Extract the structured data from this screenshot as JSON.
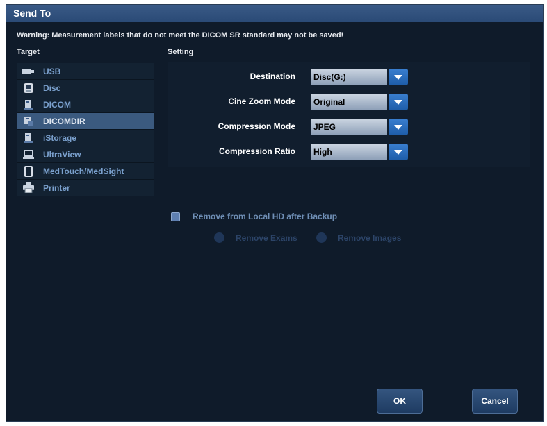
{
  "dialog": {
    "title": "Send To",
    "warning": "Warning: Measurement labels that do not meet the DICOM SR standard may not be saved!"
  },
  "target": {
    "label": "Target",
    "items": [
      {
        "label": "USB",
        "icon": "usb-icon"
      },
      {
        "label": "Disc",
        "icon": "disc-icon"
      },
      {
        "label": "DICOM",
        "icon": "dicom-icon"
      },
      {
        "label": "DICOMDIR",
        "icon": "dicomdir-icon",
        "selected": true
      },
      {
        "label": "iStorage",
        "icon": "istorage-icon"
      },
      {
        "label": "UltraView",
        "icon": "laptop-icon"
      },
      {
        "label": "MedTouch/MedSight",
        "icon": "tablet-icon"
      },
      {
        "label": "Printer",
        "icon": "printer-icon"
      }
    ]
  },
  "setting": {
    "label": "Setting",
    "destination": {
      "label": "Destination",
      "value": "Disc(G:)"
    },
    "cine_zoom_mode": {
      "label": "Cine Zoom Mode",
      "value": "Original"
    },
    "compression_mode": {
      "label": "Compression Mode",
      "value": "JPEG"
    },
    "compression_ratio": {
      "label": "Compression Ratio",
      "value": "High"
    }
  },
  "backup": {
    "checkbox_label": "Remove from Local HD after Backup",
    "remove_exams": "Remove Exams",
    "remove_images": "Remove Images"
  },
  "buttons": {
    "ok": "OK",
    "cancel": "Cancel"
  },
  "colors": {
    "background": "#0f1b2a",
    "titlebar": "#2a4a76",
    "selected_row": "#3b5a7f",
    "target_text": "#7aa0cd",
    "dropdown_button": "#1d5ca8"
  }
}
